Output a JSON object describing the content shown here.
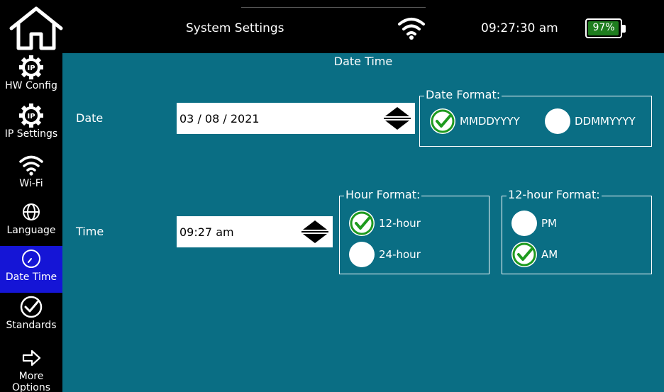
{
  "header": {
    "title": "System Settings",
    "clock": "09:27:30 am",
    "battery_percent": "97%",
    "battery_level": 0.97,
    "home_icon": "home-icon",
    "wifi_icon": "wifi-icon"
  },
  "sidebar": {
    "items": [
      {
        "label": "HW Config",
        "icon": "ip-gear-icon"
      },
      {
        "label": "IP Settings",
        "icon": "ip-gear-icon"
      },
      {
        "label": "Wi-Fi",
        "icon": "wifi-icon"
      },
      {
        "label": "Language",
        "icon": "globe-icon"
      },
      {
        "label": "Date Time",
        "icon": "clock-icon",
        "active": true
      },
      {
        "label": "Standards",
        "icon": "check-circle-icon"
      },
      {
        "label": "More",
        "label2": "Options",
        "icon": "arrow-right-icon"
      }
    ]
  },
  "main": {
    "section_title": "Date Time",
    "date": {
      "label": "Date",
      "value": "03 / 08 / 2021"
    },
    "date_format": {
      "legend": "Date Format:",
      "options": [
        {
          "label": "MMDDYYYY",
          "selected": true
        },
        {
          "label": "DDMMYYYY",
          "selected": false
        }
      ]
    },
    "time": {
      "label": "Time",
      "value": "09:27 am"
    },
    "hour_format": {
      "legend": "Hour Format:",
      "options": [
        {
          "label": "12-hour",
          "selected": true
        },
        {
          "label": "24-hour",
          "selected": false
        }
      ]
    },
    "twelve_hour_format": {
      "legend": "12-hour Format:",
      "options": [
        {
          "label": "PM",
          "selected": false
        },
        {
          "label": "AM",
          "selected": true
        }
      ]
    }
  },
  "colors": {
    "panel": "#0a6e84",
    "sidebar_active": "#1515d6",
    "check": "#1e9a1e",
    "battery": "#1e7d1e"
  }
}
